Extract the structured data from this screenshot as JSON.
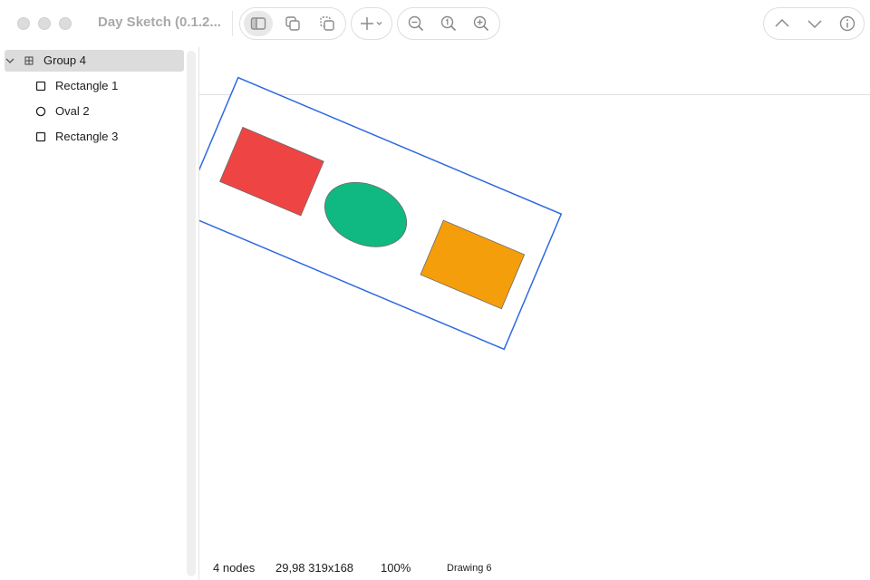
{
  "window": {
    "title": "Day Sketch (0.1.2..."
  },
  "toolbar": {
    "buttons": [
      {
        "name": "toggle-sidebar",
        "icon": "sidebar-icon",
        "active": true
      },
      {
        "name": "duplicate",
        "icon": "duplicate-icon",
        "active": false
      },
      {
        "name": "copy-style",
        "icon": "copy-style-icon",
        "active": false
      },
      {
        "name": "add-shape",
        "icon": "plus-icon",
        "active": false
      },
      {
        "name": "zoom-out",
        "icon": "zoom-out-icon",
        "active": false
      },
      {
        "name": "zoom-actual",
        "icon": "zoom-actual-icon",
        "active": false
      },
      {
        "name": "zoom-in",
        "icon": "zoom-in-icon",
        "active": false
      },
      {
        "name": "previous",
        "icon": "chevron-up-icon",
        "active": false
      },
      {
        "name": "next",
        "icon": "chevron-down-icon",
        "active": false
      },
      {
        "name": "info",
        "icon": "info-icon",
        "active": false
      }
    ]
  },
  "sidebar": {
    "items": [
      {
        "label": "Group 4",
        "icon": "group-icon",
        "expanded": true,
        "selected": true,
        "level": 0
      },
      {
        "label": "Rectangle 1",
        "icon": "rectangle-icon",
        "selected": false,
        "level": 1
      },
      {
        "label": "Oval 2",
        "icon": "oval-icon",
        "selected": false,
        "level": 1
      },
      {
        "label": "Rectangle 3",
        "icon": "rectangle-icon",
        "selected": false,
        "level": 1
      }
    ]
  },
  "canvas": {
    "shapes": [
      {
        "name": "Rectangle 1",
        "kind": "rectangle",
        "fill": "#ef4444"
      },
      {
        "name": "Oval 2",
        "kind": "oval",
        "fill": "#10b981"
      },
      {
        "name": "Rectangle 3",
        "kind": "rectangle",
        "fill": "#f59e0b"
      }
    ],
    "selection_color": "#2f6ae0",
    "stroke_color": "#6b6b6b"
  },
  "status": {
    "nodes": "4 nodes",
    "geometry": "29,98 319x168",
    "zoom": "100%",
    "document": "Drawing 6"
  }
}
